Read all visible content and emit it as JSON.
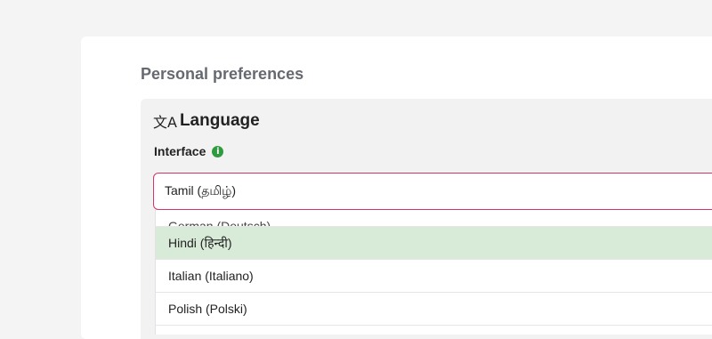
{
  "section_title": "Personal preferences",
  "panel": {
    "icon": "translate-icon",
    "icon_glyph": "文A",
    "title": "Language",
    "field_label": "Interface",
    "info_icon": "info-icon",
    "info_glyph": "i"
  },
  "select": {
    "value": "Tamil (தமிழ்)"
  },
  "options": [
    {
      "label": "German (Deutsch)"
    },
    {
      "label": "Hindi (हिन्दी)",
      "highlighted": true
    },
    {
      "label": "Italian (Italiano)"
    },
    {
      "label": "Polish (Polski)"
    }
  ],
  "colors": {
    "accent_border": "#d6336c",
    "highlight": "#d7ebd8",
    "info": "#2f9b3f"
  }
}
